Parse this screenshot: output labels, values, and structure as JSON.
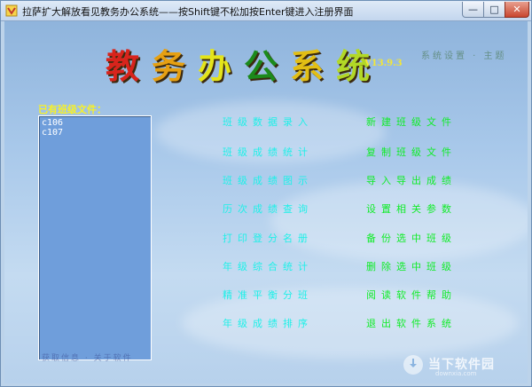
{
  "window": {
    "title": "拉萨扩大解放看见教务办公系统——按Shift键不松加按Enter键进入注册界面",
    "controls": {
      "minimize": "—",
      "maximize": "□",
      "close": "✕"
    }
  },
  "header": {
    "title_chars": [
      "教",
      "务",
      "办",
      "公",
      "系",
      "统"
    ],
    "title_colors": [
      "#d8241c",
      "#e6a012",
      "#e4e41a",
      "#1c8a1c",
      "#e2be14",
      "#b2d826"
    ],
    "version": "V13.9.3",
    "deco_right": "系统设置 · 主题",
    "deco_bottom": "获取信息 · 关于软件"
  },
  "class_files": {
    "label": "已有班级文件：",
    "items": [
      "c106",
      "c107"
    ]
  },
  "menu": {
    "left": [
      "班级数据录入",
      "班级成绩统计",
      "班级成绩图示",
      "历次成绩查询",
      "打印登分名册",
      "年级综合统计",
      "精准平衡分班",
      "年级成绩排序"
    ],
    "right": [
      "新建班级文件",
      "复制班级文件",
      "导入导出成绩",
      "设置相关参数",
      "备份选中班级",
      "删除选中班级",
      "阅读软件帮助",
      "退出软件系统"
    ],
    "colors": {
      "left": "#1ff0e8",
      "right": "#10ec28"
    }
  },
  "watermark": {
    "brand": "当下软件园",
    "url": "downxia.com"
  }
}
